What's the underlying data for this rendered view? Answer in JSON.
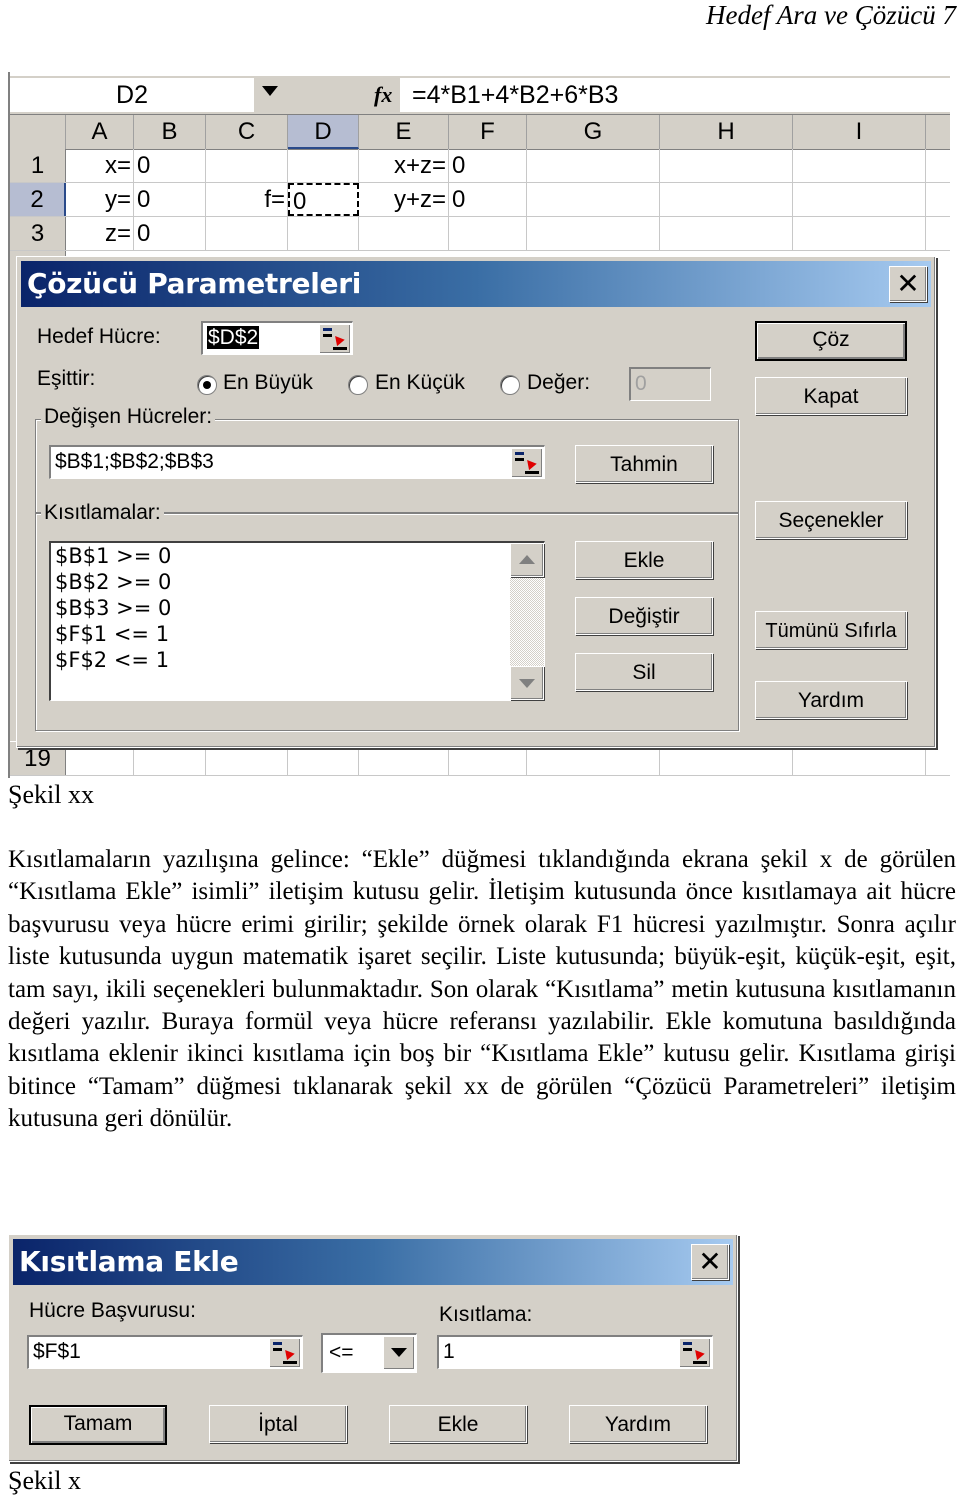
{
  "page_header": "Hedef Ara ve Çözücü 7",
  "spreadsheet": {
    "name_box": "D2",
    "fx_icon": "fx",
    "formula": "=4*B1+4*B2+6*B3",
    "columns": [
      "A",
      "B",
      "C",
      "D",
      "E",
      "F",
      "G",
      "H",
      "I"
    ],
    "selected_column": "D",
    "rows": [
      {
        "num": "1",
        "A": "x=",
        "B": "0",
        "C": "",
        "D": "",
        "E": "x+z=",
        "F": "0"
      },
      {
        "num": "2",
        "A": "y=",
        "B": "0",
        "C": "f=",
        "D": "0",
        "E": "y+z=",
        "F": "0"
      },
      {
        "num": "3",
        "A": "z=",
        "B": "0",
        "C": "",
        "D": "",
        "E": "",
        "F": ""
      }
    ],
    "bottom_row": "19"
  },
  "solver_dialog": {
    "title": "Çözücü Parametreleri",
    "close_icon": "close-icon",
    "target_cell_label": "Hedef Hücre:",
    "target_cell_value": "$D$2",
    "equals_label": "Eşittir:",
    "options": [
      {
        "label": "En Büyük",
        "checked": true
      },
      {
        "label": "En Küçük",
        "checked": false
      },
      {
        "label": "Değer:",
        "checked": false
      }
    ],
    "value_field": "0",
    "changing_cells_label": "Değişen Hücreler:",
    "changing_cells_value": "$B$1;$B$2;$B$3",
    "guess_button": "Tahmin",
    "constraints_label": "Kısıtlamalar:",
    "constraints": [
      "$B$1 >= 0",
      "$B$2 >= 0",
      "$B$3 >= 0",
      "$F$1 <= 1",
      "$F$2 <= 1"
    ],
    "add_button": "Ekle",
    "change_button": "Değiştir",
    "delete_button": "Sil",
    "solve_button": "Çöz",
    "close_button": "Kapat",
    "options_button": "Seçenekler",
    "reset_button": "Tümünü Sıfırla",
    "help_button": "Yardım"
  },
  "caption_1": "Şekil xx",
  "paragraph": "Kısıtlamaların yazılışına gelince: “Ekle” düğmesi tıklandığında ekrana şekil x de görülen “Kısıtlama Ekle” isimli” iletişim kutusu gelir. İletişim kutusunda önce kısıtlamaya ait hücre başvurusu veya hücre erimi girilir; şekilde örnek olarak F1 hücresi yazılmıştır. Sonra açılır liste kutusunda uygun matematik işaret seçilir. Liste kutusunda; büyük-eşit, küçük-eşit, eşit, tam sayı, ikili seçenekleri bulunmaktadır. Son olarak “Kısıtlama” metin kutusuna kısıtlamanın değeri yazılır. Buraya formül veya hücre referansı yazılabilir. Ekle komutuna basıldığında kısıtlama eklenir ikinci kısıtlama için boş bir “Kısıtlama Ekle” kutusu gelir. Kısıtlama girişi bitince “Tamam” düğmesi tıklanarak şekil xx de görülen “Çözücü Parametreleri” iletişim kutusuna geri dönülür.",
  "constraint_dialog": {
    "title": "Kısıtlama Ekle",
    "cell_ref_label": "Hücre Başvurusu:",
    "cell_ref_value": "$F$1",
    "operator": "<=",
    "constraint_label": "Kısıtlama:",
    "constraint_value": "1",
    "ok_button": "Tamam",
    "cancel_button": "İptal",
    "add_button": "Ekle",
    "help_button": "Yardım"
  },
  "caption_2": "Şekil x"
}
